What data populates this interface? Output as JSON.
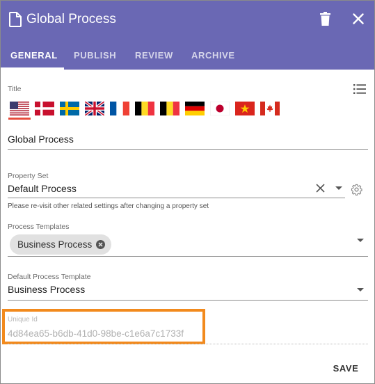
{
  "header": {
    "title": "Global Process"
  },
  "tabs": [
    {
      "label": "GENERAL",
      "active": true
    },
    {
      "label": "PUBLISH",
      "active": false
    },
    {
      "label": "REVIEW",
      "active": false
    },
    {
      "label": "ARCHIVE",
      "active": false
    }
  ],
  "title_field": {
    "label": "Title",
    "value": "Global Process",
    "languages": [
      "en-us",
      "da",
      "sv",
      "en-gb",
      "fr",
      "nl-be",
      "de-be",
      "de",
      "ja",
      "vi",
      "ca"
    ],
    "selected_language": "en-us"
  },
  "property_set": {
    "label": "Property Set",
    "value": "Default Process",
    "hint": "Please re-visit other related settings after changing a property set"
  },
  "process_templates": {
    "label": "Process Templates",
    "chips": [
      "Business Process"
    ]
  },
  "default_template": {
    "label": "Default Process Template",
    "value": "Business Process"
  },
  "unique_id": {
    "label": "Unique Id",
    "value": "4d84ea65-b6db-41d0-98be-c1e6a7c1733f"
  },
  "actions": {
    "save_label": "SAVE"
  },
  "colors": {
    "header": "#6a68b4",
    "highlight": "#f28a1d"
  }
}
